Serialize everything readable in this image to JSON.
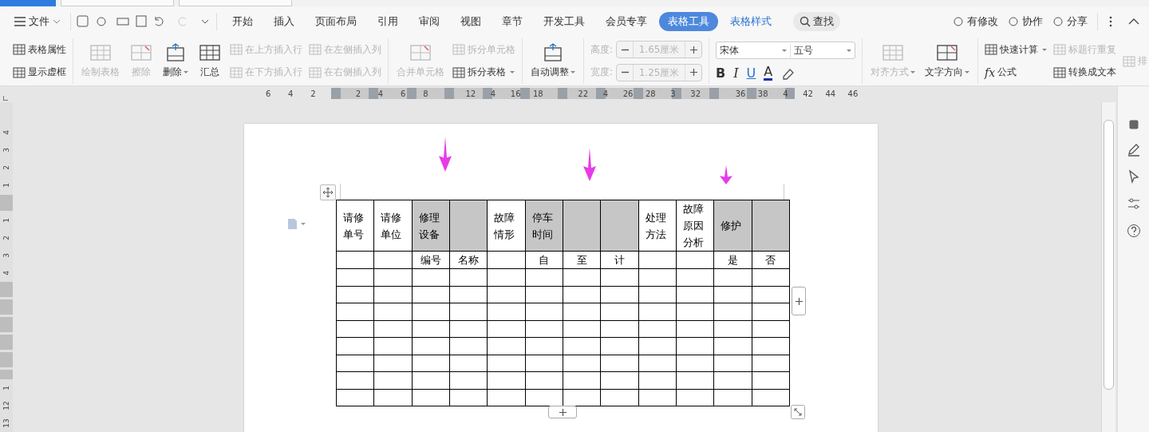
{
  "window_tabs": [
    {
      "selected": true
    },
    {
      "selected": false
    },
    {
      "selected": false
    }
  ],
  "menu": {
    "file": "文件",
    "tabs": [
      {
        "label": "开始",
        "selected": false
      },
      {
        "label": "插入",
        "selected": false
      },
      {
        "label": "页面布局",
        "selected": false
      },
      {
        "label": "引用",
        "selected": false
      },
      {
        "label": "审阅",
        "selected": false
      },
      {
        "label": "视图",
        "selected": false
      },
      {
        "label": "章节",
        "selected": false
      },
      {
        "label": "开发工具",
        "selected": false
      },
      {
        "label": "会员专享",
        "selected": false
      },
      {
        "label": "表格工具",
        "selected": true
      },
      {
        "label": "表格样式",
        "selected": false
      }
    ],
    "search": "查找",
    "actions": [
      "有修改",
      "协作",
      "分享"
    ]
  },
  "ribbon": [
    {
      "columns": [
        [
          {
            "kind": "small",
            "label": "表格属性",
            "disabled": false
          },
          {
            "kind": "small",
            "label": "显示虚框",
            "disabled": false
          }
        ]
      ]
    },
    {
      "columns": [
        [
          {
            "kind": "large",
            "label": "绘制表格",
            "disabled": true
          }
        ],
        [
          {
            "kind": "large",
            "label": "擦除",
            "disabled": true
          }
        ],
        [
          {
            "kind": "large",
            "label": "删除",
            "disabled": false,
            "dropdown": true
          }
        ],
        [
          {
            "kind": "large",
            "label": "汇总",
            "disabled": false
          }
        ],
        [
          {
            "kind": "small",
            "label": "在上方插入行",
            "disabled": true
          },
          {
            "kind": "small",
            "label": "在下方插入行",
            "disabled": true
          }
        ],
        [
          {
            "kind": "small",
            "label": "在左侧插入列",
            "disabled": true
          },
          {
            "kind": "small",
            "label": "在右侧插入列",
            "disabled": true
          }
        ]
      ]
    },
    {
      "columns": [
        [
          {
            "kind": "large",
            "label": "合并单元格",
            "disabled": true
          }
        ],
        [
          {
            "kind": "small",
            "label": "拆分单元格",
            "disabled": true
          },
          {
            "kind": "small",
            "label": "拆分表格",
            "disabled": false,
            "dropdown": true
          }
        ]
      ]
    },
    {
      "columns": [
        [
          {
            "kind": "large",
            "label": "自动调整",
            "disabled": false,
            "dropdown": true
          }
        ]
      ]
    },
    {
      "columns": [
        [
          {
            "kind": "spinner",
            "label": "高度:",
            "value": "1.65厘米",
            "disabled": true
          },
          {
            "kind": "spinner",
            "label": "宽度:",
            "value": "1.25厘米",
            "disabled": true
          }
        ]
      ]
    },
    {
      "columns": [
        [
          {
            "kind": "fonts",
            "font": "宋体",
            "size": "五号"
          },
          {
            "kind": "format",
            "buttons": [
              "B",
              "I",
              "U",
              "A"
            ]
          }
        ]
      ]
    },
    {
      "columns": [
        [
          {
            "kind": "large",
            "label": "对齐方式",
            "disabled": true,
            "dropdown": true
          }
        ],
        [
          {
            "kind": "large",
            "label": "文字方向",
            "disabled": false,
            "dropdown": true
          }
        ]
      ]
    },
    {
      "columns": [
        [
          {
            "kind": "small",
            "label": "快速计算",
            "disabled": false,
            "dropdown": true
          },
          {
            "kind": "small",
            "glyph": "fx",
            "label": "公式",
            "disabled": false
          }
        ],
        [
          {
            "kind": "small",
            "label": "标题行重复",
            "disabled": true
          },
          {
            "kind": "small",
            "label": "转换成文本",
            "disabled": false
          }
        ],
        [
          {
            "kind": "small",
            "label": "排",
            "disabled": true
          }
        ]
      ]
    }
  ],
  "ruler": [
    [
      "6",
      "4",
      "2"
    ],
    [
      "2",
      "4",
      "6",
      "8"
    ],
    [
      "12",
      "4",
      "16",
      "18"
    ],
    [
      "22",
      "4",
      "26",
      "28",
      "3",
      "32"
    ],
    [
      "36",
      "38",
      "4",
      "42",
      "44",
      "46"
    ]
  ],
  "vruler": [
    [
      "4",
      "3",
      "2",
      "1"
    ],
    [
      "1",
      "2",
      "3",
      "4"
    ],
    [
      "1",
      "12",
      "13"
    ]
  ],
  "table": {
    "columns": [
      {
        "text": "请修单号",
        "shaded": false
      },
      {
        "text": "请修单位",
        "shaded": false
      },
      {
        "text": "修理设备",
        "shaded": true,
        "sub": "编号"
      },
      {
        "shaded": true,
        "sub": "名称"
      },
      {
        "text": "故障情形",
        "shaded": false
      },
      {
        "text": "停车时间",
        "shaded": true,
        "sub": "自"
      },
      {
        "shaded": true,
        "sub": "至"
      },
      {
        "shaded": true,
        "sub": "计"
      },
      {
        "text": "处理方法",
        "shaded": false
      },
      {
        "text": "故障原因分析",
        "shaded": false
      },
      {
        "text": "修护",
        "shaded": true,
        "sub": "是"
      },
      {
        "shaded": true,
        "sub": "否"
      }
    ]
  }
}
